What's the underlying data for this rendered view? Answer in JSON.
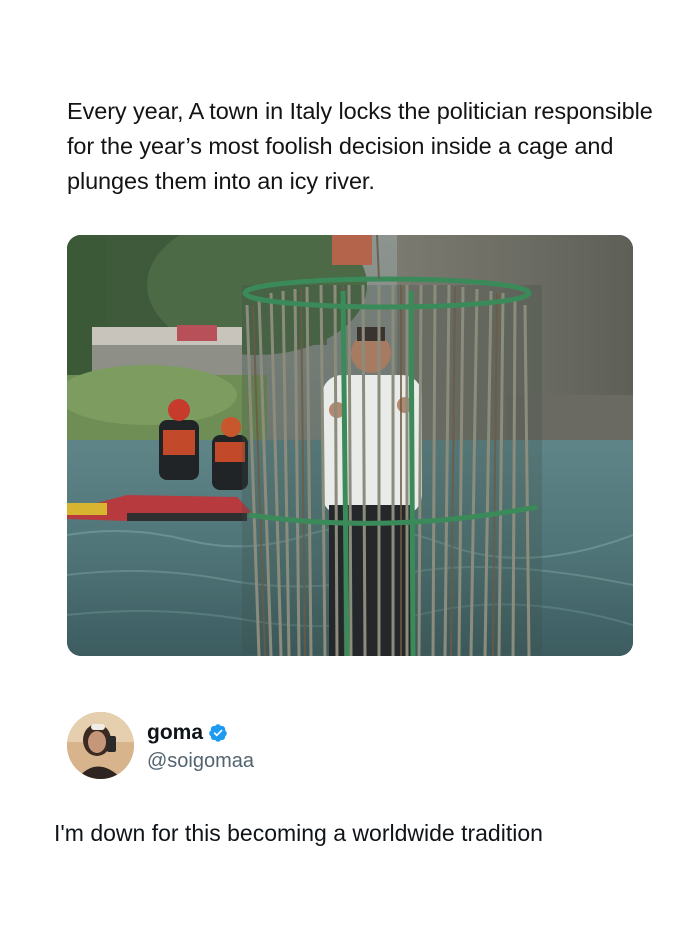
{
  "post": {
    "caption": "Every year, A town in Italy locks the politician responsible for the year’s most foolish decision inside a cage and plunges them into an icy river."
  },
  "quoted_tweet": {
    "display_name": "goma",
    "handle": "@soigomaa",
    "verified": true,
    "text": "I'm down for this becoming a worldwide tradition"
  },
  "icons": {
    "verified": "verified-badge-icon",
    "avatar": "avatar"
  },
  "colors": {
    "verified_badge": "#1d9bf0",
    "handle": "#536471",
    "text": "#0f1419"
  }
}
